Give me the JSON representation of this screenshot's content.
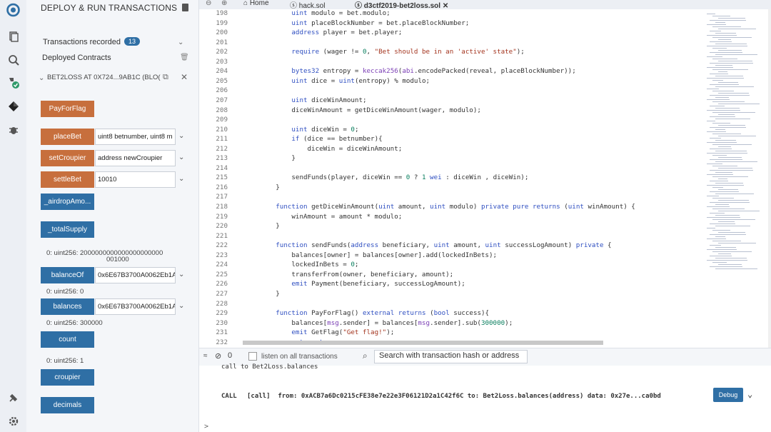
{
  "sidebar": {
    "title": "DEPLOY & RUN TRANSACTIONS",
    "transactions_label": "Transactions recorded",
    "transactions_count": "13",
    "deployed_label": "Deployed Contracts",
    "contract_title": "BET2LOSS AT 0X724...9AB1C (BLO("
  },
  "functions": [
    {
      "name": "PayForFlag",
      "kind": "orange",
      "input": "",
      "output": ""
    },
    {
      "name": "placeBet",
      "kind": "orange",
      "input": "uint8 betnumber, uint8 m",
      "output": ""
    },
    {
      "name": "setCroupier",
      "kind": "orange",
      "input": "address newCroupier",
      "output": ""
    },
    {
      "name": "settleBet",
      "kind": "orange",
      "input": "10010",
      "output": ""
    },
    {
      "name": "_airdropAmo...",
      "kind": "blue",
      "input": "",
      "output": ""
    },
    {
      "name": "_totalSupply",
      "kind": "blue",
      "input": "",
      "output": "0: uint256: 2000000000000000000000"
    },
    {
      "name": "balanceOf",
      "kind": "blue",
      "input": "0x6E67B3700A0062Eb1A",
      "output": "0: uint256: 0"
    },
    {
      "name": "balances",
      "kind": "blue",
      "input": "0x6E67B3700A0062Eb1A",
      "output": "0: uint256: 300000"
    },
    {
      "name": "count",
      "kind": "blue",
      "input": "",
      "output": "0: uint256: 1"
    },
    {
      "name": "croupier",
      "kind": "blue",
      "input": "",
      "output": ""
    },
    {
      "name": "decimals",
      "kind": "blue",
      "input": "",
      "output": ""
    }
  ],
  "output_extra": "001000",
  "tabs": [
    "Home",
    "hack.sol",
    "d3ctf2019-bet2loss.sol"
  ],
  "code_lines": [
    {
      "n": "198",
      "t": "            uint modulo = bet.modulo;"
    },
    {
      "n": "199",
      "t": "            uint placeBlockNumber = bet.placeBlockNumber;"
    },
    {
      "n": "200",
      "t": "            address player = bet.player;"
    },
    {
      "n": "201",
      "t": ""
    },
    {
      "n": "202",
      "t": "            require (wager != 0, \"Bet should be in an 'active' state\");"
    },
    {
      "n": "203",
      "t": ""
    },
    {
      "n": "204",
      "t": "            bytes32 entropy = keccak256(abi.encodePacked(reveal, placeBlockNumber));"
    },
    {
      "n": "205",
      "t": "            uint dice = uint(entropy) % modulo;"
    },
    {
      "n": "206",
      "t": ""
    },
    {
      "n": "207",
      "t": "            uint diceWinAmount;"
    },
    {
      "n": "208",
      "t": "            diceWinAmount = getDiceWinAmount(wager, modulo);"
    },
    {
      "n": "209",
      "t": ""
    },
    {
      "n": "210",
      "t": "            uint diceWin = 0;"
    },
    {
      "n": "211",
      "t": "            if (dice == betnumber){"
    },
    {
      "n": "212",
      "t": "                diceWin = diceWinAmount;"
    },
    {
      "n": "213",
      "t": "            }"
    },
    {
      "n": "214",
      "t": ""
    },
    {
      "n": "215",
      "t": "            sendFunds(player, diceWin == 0 ? 1 wei : diceWin , diceWin);"
    },
    {
      "n": "216",
      "t": "        }"
    },
    {
      "n": "217",
      "t": ""
    },
    {
      "n": "218",
      "t": "        function getDiceWinAmount(uint amount, uint modulo) private pure returns (uint winAmount) {"
    },
    {
      "n": "219",
      "t": "            winAmount = amount * modulo;"
    },
    {
      "n": "220",
      "t": "        }"
    },
    {
      "n": "221",
      "t": ""
    },
    {
      "n": "222",
      "t": "        function sendFunds(address beneficiary, uint amount, uint successLogAmount) private {"
    },
    {
      "n": "223",
      "t": "            balances[owner] = balances[owner].add(lockedInBets);"
    },
    {
      "n": "224",
      "t": "            lockedInBets = 0;"
    },
    {
      "n": "225",
      "t": "            transferFrom(owner, beneficiary, amount);"
    },
    {
      "n": "226",
      "t": "            emit Payment(beneficiary, successLogAmount);"
    },
    {
      "n": "227",
      "t": "        }"
    },
    {
      "n": "228",
      "t": ""
    },
    {
      "n": "229",
      "t": "        function PayForFlag() external returns (bool success){"
    },
    {
      "n": "230",
      "t": "            balances[msg.sender] = balances[msg.sender].sub(300000);"
    },
    {
      "n": "231",
      "t": "            emit GetFlag(\"Get flag!\");"
    },
    {
      "n": "232",
      "t": "            return true;"
    }
  ],
  "terminal": {
    "listen_label": "listen on all transactions",
    "search_placeholder": "Search with transaction hash or address",
    "prev_line": "call to Bet2Loss.balances",
    "call_label": "CALL",
    "call_line": "[call]  from: 0xACB7a6Dc0215cFE38e7e22e3F06121D2a1C42f6C to: Bet2Loss.balances(address) data: 0x27e...ca0bd",
    "debug_label": "Debug",
    "prompt": ">"
  },
  "colors": {
    "orange": "#c76f3d",
    "blue": "#2f6fa5"
  }
}
